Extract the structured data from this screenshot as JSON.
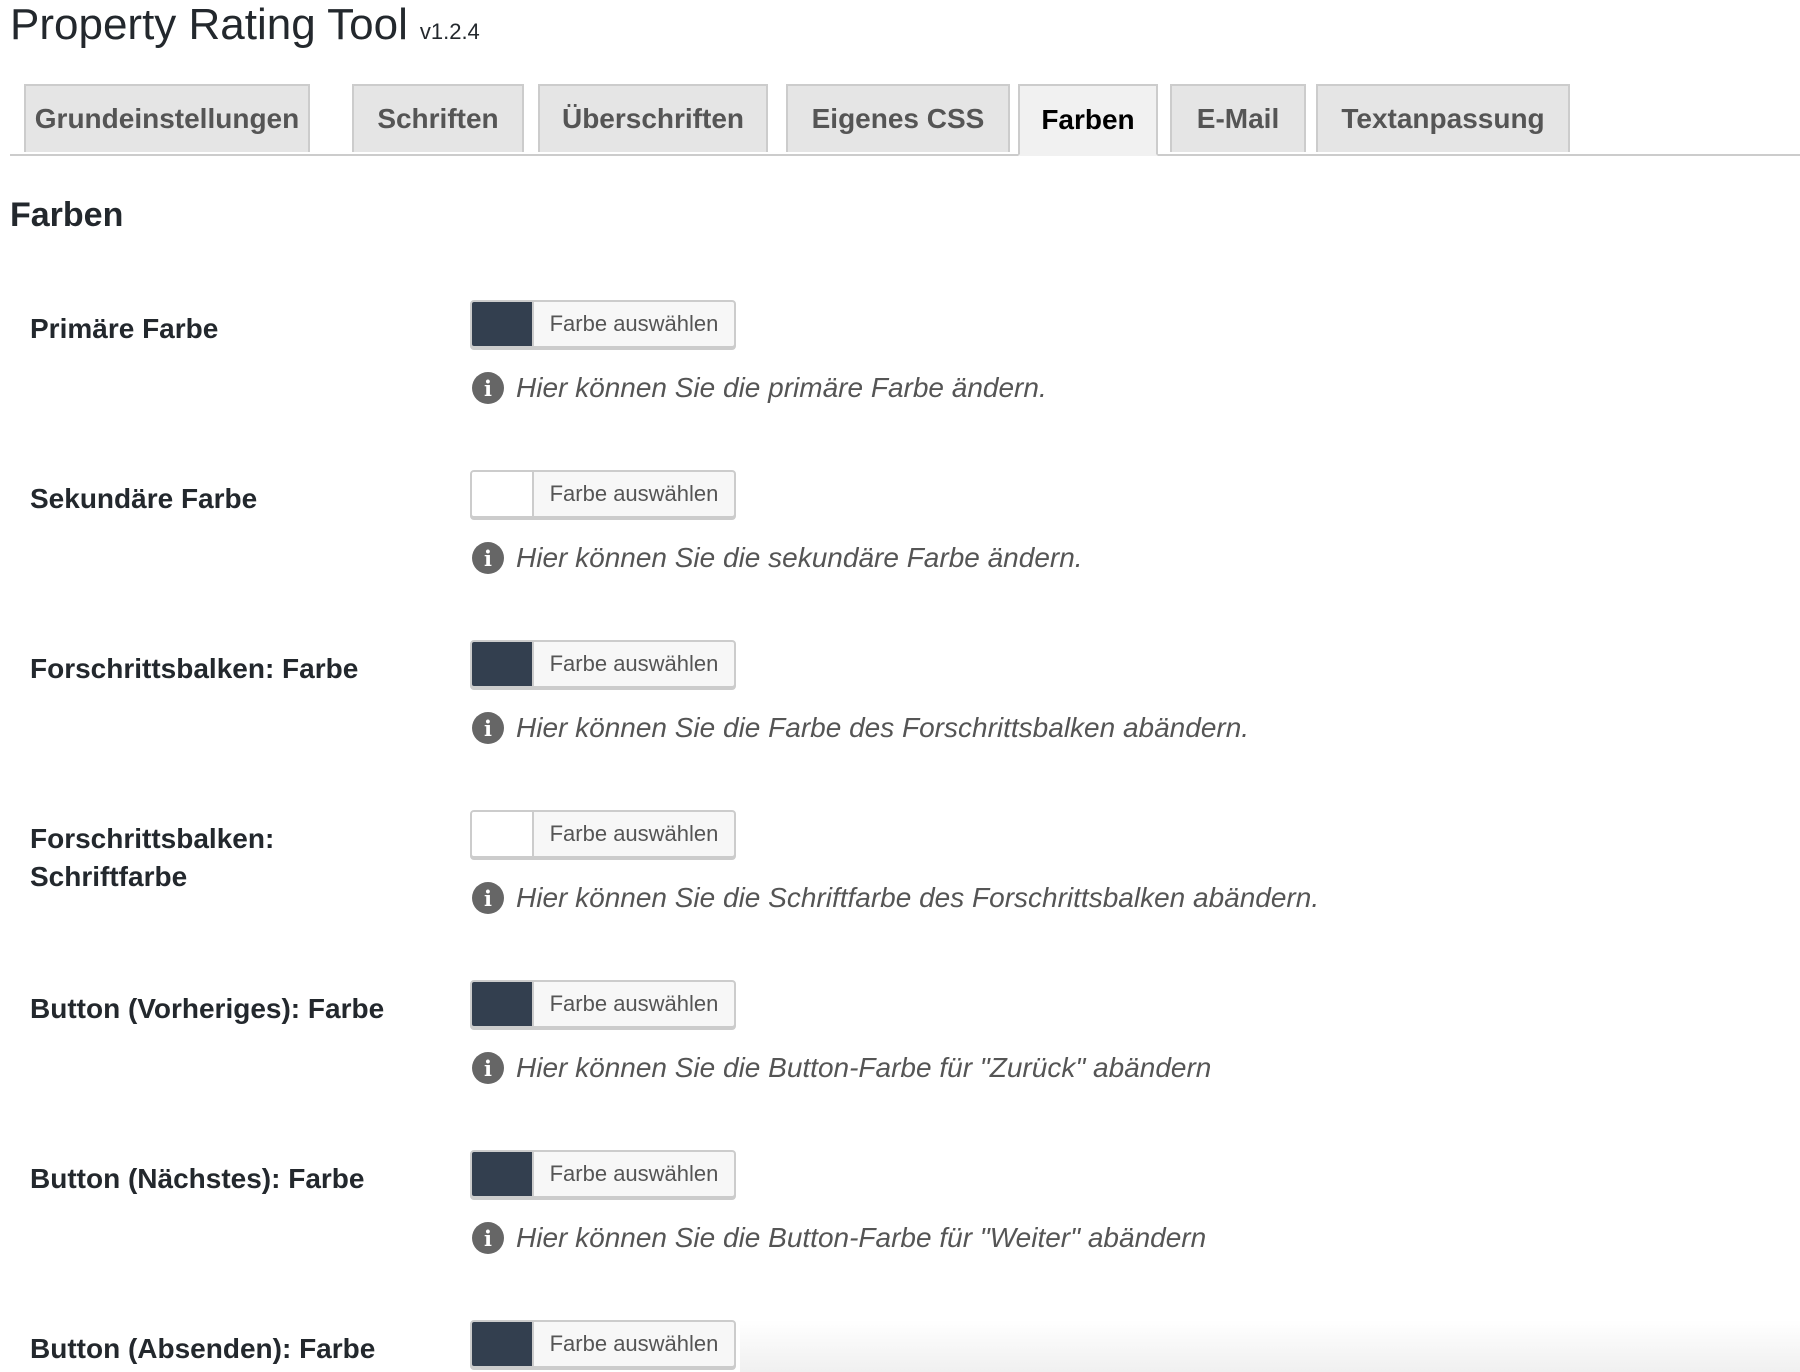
{
  "app": {
    "title": "Property Rating Tool",
    "version": "v1.2.4"
  },
  "tabs": [
    {
      "label": "Grundeinstellungen",
      "active": false
    },
    {
      "label": "Schriften",
      "active": false
    },
    {
      "label": "Überschriften",
      "active": false
    },
    {
      "label": "Eigenes CSS",
      "active": false
    },
    {
      "label": "Farben",
      "active": true
    },
    {
      "label": "E-Mail",
      "active": false
    },
    {
      "label": "Textanpassung",
      "active": false
    }
  ],
  "section": {
    "title": "Farben"
  },
  "settings": [
    {
      "label": "Primäre Farbe",
      "button": "Farbe auswählen",
      "color": "#333f4f",
      "description": "Hier können Sie die primäre Farbe ändern."
    },
    {
      "label": "Sekundäre Farbe",
      "button": "Farbe auswählen",
      "color": "#ffffff",
      "description": "Hier können Sie die sekundäre Farbe ändern."
    },
    {
      "label": "Forschrittsbalken: Farbe",
      "button": "Farbe auswählen",
      "color": "#333f4f",
      "description": "Hier können Sie die Farbe des Forschrittsbalken abändern."
    },
    {
      "label": "Forschrittsbalken: Schriftfarbe",
      "label_line1": "Forschrittsbalken:",
      "label_line2": "Schriftfarbe",
      "button": "Farbe auswählen",
      "color": "#ffffff",
      "description": "Hier können Sie die Schriftfarbe des Forschrittsbalken abändern."
    },
    {
      "label": "Button (Vorheriges): Farbe",
      "button": "Farbe auswählen",
      "color": "#333f4f",
      "description": "Hier können Sie die Button-Farbe für \"Zurück\" abändern"
    },
    {
      "label": "Button (Nächstes): Farbe",
      "button": "Farbe auswählen",
      "color": "#333f4f",
      "description": "Hier können Sie die Button-Farbe für \"Weiter\" abändern"
    },
    {
      "label": "Button (Absenden): Farbe",
      "button": "Farbe auswählen",
      "color": "#333f4f"
    }
  ],
  "icons": {
    "info": "info-circle-icon"
  }
}
